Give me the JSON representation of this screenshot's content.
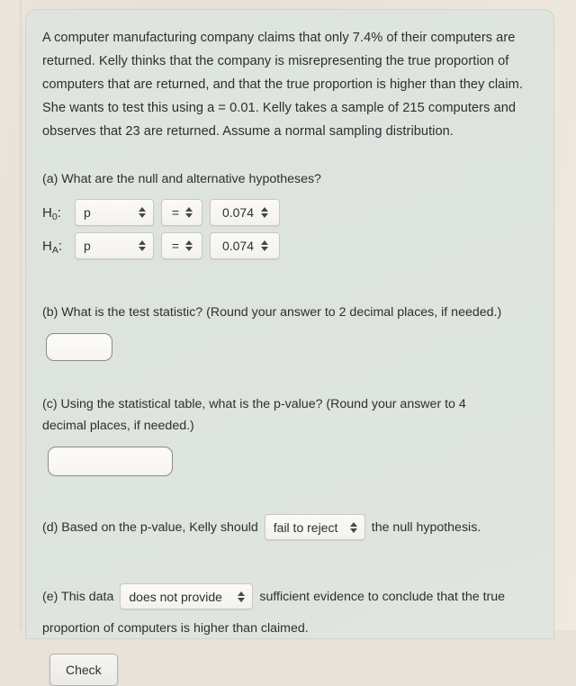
{
  "problem": {
    "text": "A computer manufacturing company claims that only 7.4% of their computers are returned. Kelly thinks that the company is misrepresenting the true proportion of computers that are returned, and that the true proportion is higher than they claim. She wants to test this using a = 0.01. Kelly takes a sample of 215 computers and observes that 23 are returned. Assume a normal sampling distribution."
  },
  "part_a": {
    "question": "(a) What are the null and alternative hypotheses?",
    "null_label": "H",
    "null_sub": "0",
    "alt_label": "H",
    "alt_sub": "A",
    "colon": ":",
    "rows": [
      {
        "parameter": "p",
        "operator": "=",
        "value": "0.074"
      },
      {
        "parameter": "p",
        "operator": "=",
        "value": "0.074"
      }
    ]
  },
  "part_b": {
    "question": "(b) What is the test statistic? (Round your answer to 2 decimal places, if needed.)",
    "answer": "",
    "placeholder": ""
  },
  "part_c": {
    "question_line1": "(c) Using the statistical table, what is the p-value? (Round your answer to 4",
    "question_line2": "decimal places, if needed.)",
    "answer": "",
    "placeholder": ""
  },
  "part_d": {
    "prefix": "(d) Based on the p-value, Kelly should",
    "decision": "fail to reject",
    "suffix": "the null hypothesis."
  },
  "part_e": {
    "prefix": "(e) This data",
    "evidence": "does not provide",
    "suffix": "sufficient evidence to conclude that the true",
    "second_line": "proportion of computers is higher than claimed."
  },
  "actions": {
    "check_label": "Check"
  },
  "icons": {
    "stepper": "up-down-arrows-icon"
  },
  "colors": {
    "card_background": "#dde3dd",
    "page_background": "#e8e2d8",
    "text": "#2b3033",
    "control_background": "#f8f6f3",
    "control_border": "#c8c8c4"
  }
}
